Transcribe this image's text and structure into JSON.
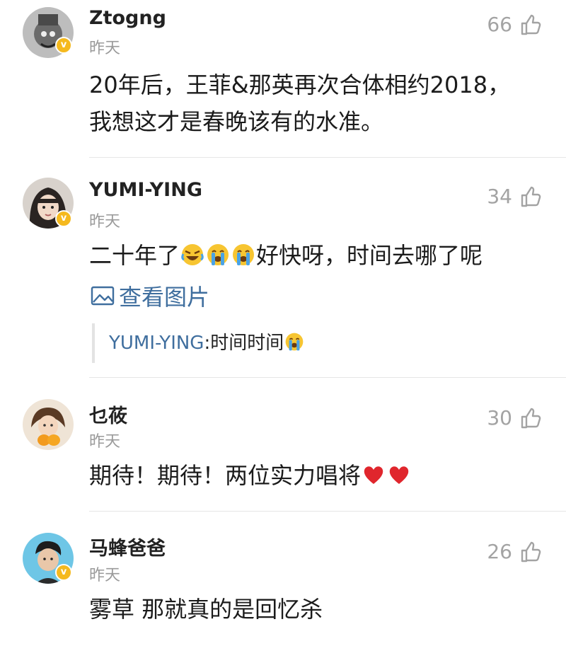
{
  "comments": [
    {
      "username": "Ztogng",
      "time": "昨天",
      "likes": "66",
      "text_line1": "20年后，王菲&那英再次合体相约2018，",
      "text_line2": "我想这才是春晚该有的水准。"
    },
    {
      "username": "YUMI-YING",
      "time": "昨天",
      "likes": "34",
      "text_prefix": "二十年了",
      "text_suffix": "好快呀，时间去哪了呢",
      "view_image": "查看图片",
      "reply_user": "YUMI-YING",
      "reply_text": ":时间时间"
    },
    {
      "username": "乜莜",
      "time": "昨天",
      "likes": "30",
      "text": "期待！期待！两位实力唱将"
    },
    {
      "username": "马蜂爸爸",
      "time": "昨天",
      "likes": "26",
      "text": "雾草 那就真的是回忆杀"
    }
  ],
  "verified_badge": "v",
  "icons": {
    "like": "thumbs-up-outline-icon",
    "image": "image-icon",
    "emoji_laugh_cry": "laughing-crying-face",
    "emoji_cry": "loudly-crying-face",
    "emoji_heart": "red-heart"
  },
  "colors": {
    "link": "#3f6e9e",
    "muted": "#9a9a9a",
    "badge": "#f5b91e",
    "heart": "#e0262d"
  }
}
